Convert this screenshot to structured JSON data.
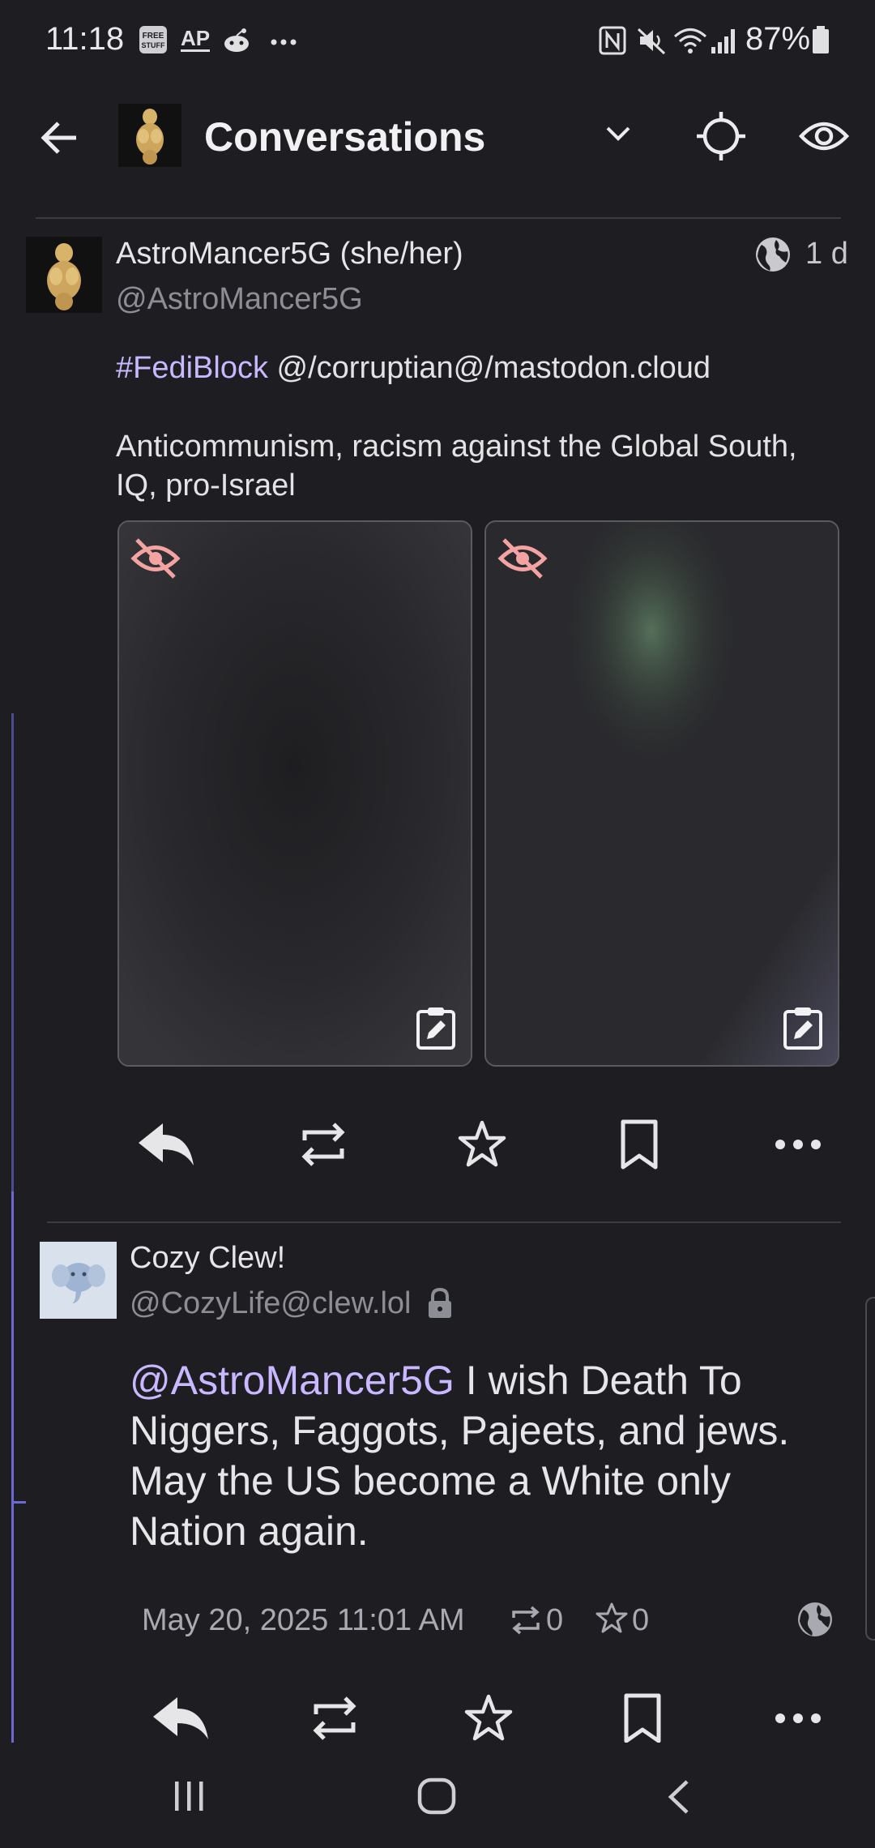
{
  "status_bar": {
    "time": "11:18",
    "battery": "87%",
    "notif_icons": [
      "free-stuff-icon",
      "ap-news-icon",
      "reddit-icon",
      "more-dots-icon"
    ],
    "system_icons": [
      "nfc-icon",
      "mute-icon",
      "wifi-icon",
      "signal-icon",
      "battery-icon"
    ]
  },
  "app_bar": {
    "title": "Conversations",
    "icons": [
      "back-arrow-icon",
      "chevron-down-icon",
      "crosshair-icon",
      "eye-icon"
    ]
  },
  "post": {
    "display_name": "AstroMancer5G (she/her)",
    "handle": "@AstroMancer5G",
    "age": "1 d",
    "visibility_icon": "globe-icon",
    "hashtag": "#FediBlock",
    "line1_rest": " @/corruptian@/mastodon.cloud",
    "line2": "Anticommunism, racism against the Global South, IQ, pro-Israel",
    "media": [
      {
        "state": "hidden",
        "icons": [
          "eye-off-icon",
          "alt-text-icon"
        ]
      },
      {
        "state": "hidden",
        "icons": [
          "eye-off-icon",
          "alt-text-icon"
        ]
      }
    ],
    "actions": [
      "reply-icon",
      "boost-icon",
      "favourite-icon",
      "bookmark-icon",
      "more-icon"
    ]
  },
  "reply": {
    "display_name": "Cozy Clew!",
    "handle": "@CozyLife@clew.lol",
    "locked_icon": "lock-icon",
    "mention": "@AstroMancer5G",
    "body_rest": " I wish Death To Niggers, Faggots, Pajeets, and jews. May the US become a White only Nation again.",
    "timestamp": "May 20, 2025 11:01 AM",
    "boosts": "0",
    "favourites": "0",
    "visibility_icon": "globe-icon",
    "actions": [
      "reply-icon",
      "boost-icon",
      "favourite-icon",
      "bookmark-icon",
      "more-icon"
    ]
  },
  "nav_bar": {
    "icons": [
      "recents-icon",
      "home-icon",
      "back-icon"
    ]
  },
  "colors": {
    "background": "#1e1e22",
    "accent": "#c9b8ff",
    "thread_line": "#6b6ad3",
    "sensitive_icon": "#f4a3a3"
  }
}
